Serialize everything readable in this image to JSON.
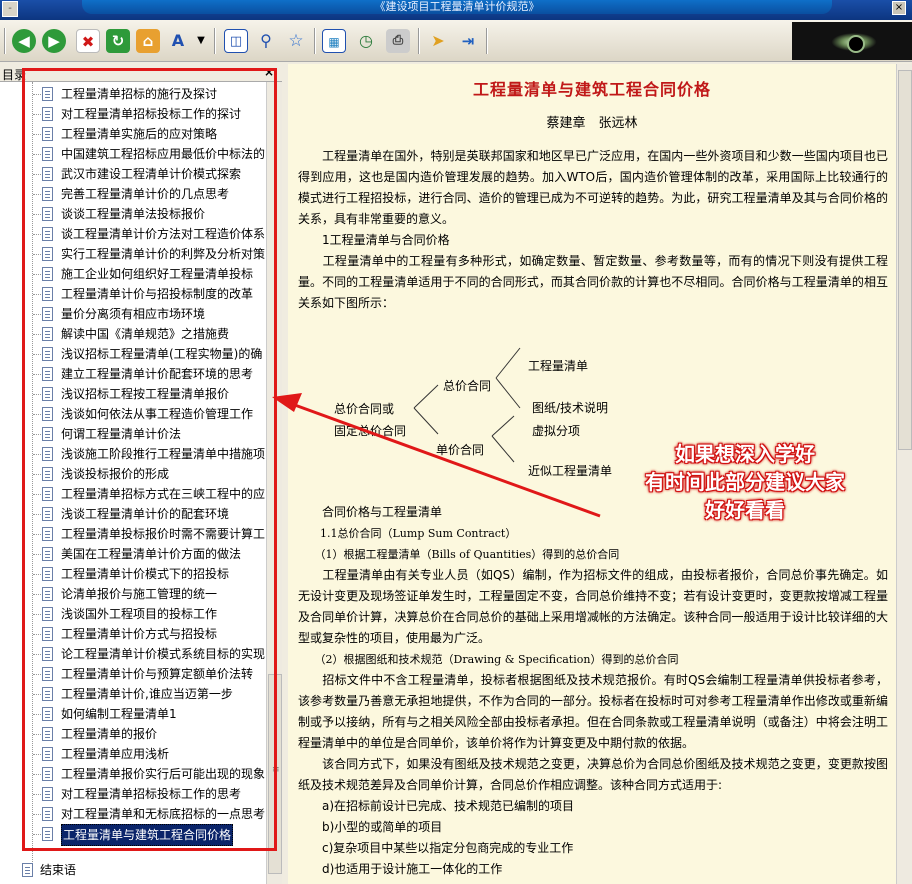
{
  "window": {
    "title": "《建设项目工程量清单计价规范》",
    "left_control": "-",
    "close_label": "×"
  },
  "toolbar": {
    "icons": [
      "back-icon",
      "forward-icon",
      "stop-icon",
      "refresh-icon",
      "home-icon",
      "font-icon",
      "dropdown-icon",
      "panel-icon",
      "search-icon",
      "favorite-icon",
      "image-icon",
      "history-icon",
      "print-icon",
      "pointer-icon",
      "export-icon"
    ]
  },
  "sidebar": {
    "title": "目录",
    "close": "×",
    "items": [
      "工程量清单招标的施行及探讨",
      "对工程量清单招标投标工作的探讨",
      "工程量清单实施后的应对策略",
      "中国建筑工程招标应用最低价中标法的",
      "武汉市建设工程清单计价模式探索",
      "完善工程量清单计价的几点思考",
      "谈谈工程量清单法投标报价",
      "谈工程量清单计价方法对工程造价体系",
      "实行工程量清单计价的利弊及分析对策",
      "施工企业如何组织好工程量清单投标",
      "工程量清单计价与招投标制度的改革",
      "量价分离须有相应市场环境",
      "解读中国《清单规范》之措施费",
      "浅议招标工程量清单(工程实物量)的确",
      "建立工程量清单计价配套环境的思考",
      "浅议招标工程按工程量清单报价",
      "浅谈如何依法从事工程造价管理工作",
      "何谓工程量清单计价法",
      "浅谈施工阶段推行工程量清单中措施项目的",
      "浅谈投标报价的形成",
      "工程量清单招标方式在三峡工程中的应",
      "浅谈工程量清单计价的配套环境",
      "工程量清单投标报价时需不需要计算工",
      "美国在工程量清单计价方面的做法",
      "工程量清单计价模式下的招投标",
      "论清单报价与施工管理的统一",
      "浅谈国外工程项目的投标工作",
      "工程量清单计价方式与招投标",
      "论工程量清单计价模式系统目标的实现",
      "工程量清单计价与预算定额单价法转",
      "工程量清单计价,谁应当迈第一步",
      "如何编制工程量清单1",
      "工程量清单的报价",
      "工程量清单应用浅析",
      "工程量清单报价实行后可能出现的现象",
      "对工程量清单招标投标工作的思考",
      "对工程量清单和无标底招标的一点思考",
      "工程量清单与建筑工程合同价格"
    ],
    "selected_index": 37,
    "last_item": "结束语"
  },
  "article": {
    "title": "工程量清单与建筑工程合同价格",
    "authors": "蔡建章　张远林",
    "p1": "　　工程量清单在国外，特别是英联邦国家和地区早已广泛应用，在国内一些外资项目和少数一些国内项目也已得到应用，这也是国内造价管理发展的趋势。加入WTO后，国内造价管理体制的改革，采用国际上比较通行的模式进行工程招投标，进行合同、造价的管理已成为不可逆转的趋势。为此，研究工程量清单及其与合同价格的关系，具有非常重要的意义。",
    "h1": "　　1工程量清单与合同价格",
    "p2": "　　工程量清单中的工程量有多种形式，如确定数量、暂定数量、参考数量等，而有的情况下则没有提供工程量。不同的工程量清单适用于不同的合同形式，而其合同价款的计算也不尽相同。合同价格与工程量清单的相互关系如下图所示：",
    "diagram": {
      "root1": "总价合同或",
      "root2": "固定总价合同",
      "mid1": "总价合同",
      "mid2": "单价合同",
      "leaf1": "工程量清单",
      "leaf2": "图纸/技术说明",
      "leaf3": "虚拟分项",
      "leaf4": "近似工程量清单"
    },
    "h2": "　　合同价格与工程量清单",
    "h3": "　　1.1总价合同（Lump Sum Contract）",
    "h4": "　　（1）根据工程量清单（Bills of Quantities）得到的总价合同",
    "p3": "　　工程量清单由有关专业人员（如QS）编制，作为招标文件的组成，由投标者报价，合同总价事先确定。如无设计变更及现场签证单发生时，工程量固定不变，合同总价维持不变；若有设计变更时，变更款按增减工程量及合同单价计算，决算总价在合同总价的基础上采用增减帐的方法确定。该种合同一般适用于设计比较详细的大型或复杂性的项目，使用最为广泛。",
    "h5": "　　（2）根据图纸和技术规范（Drawing & Specification）得到的总价合同",
    "p4": "　　招标文件中不含工程量清单，投标者根据图纸及技术规范报价。有时QS会编制工程量清单供投标者参考，该参考数量乃善意无承担地提供，不作为合同的一部分。投标者在投标时可对参考工程量清单作出修改或重新编制或予以接纳，所有与之相关风险全部由投标者承担。但在合同条款或工程量清单说明（或备注）中将会注明工程量清单中的单位是合同单价，该单价将作为计算变更及中期付款的依据。",
    "p5": "　　该合同方式下，如果没有图纸及技术规范之变更，决算总价为合同总价图纸及技术规范之变更，变更款按图纸及技术规范差异及合同单价计算，合同总价作相应调整。该种合同方式适用于:",
    "li1": "　　a)在招标前设计已完成、技术规范已编制的项目",
    "li2": "　　b)小型的或简单的项目",
    "li3": "　　c)复杂项目中某些以指定分包商完成的专业工作",
    "li4": "　　d)也适用于设计施工一体化的工作"
  },
  "annotation": {
    "line1": "如果想深入学好",
    "line2": "有时间此部分建议大家",
    "line3": "好好看看",
    "color": "#e01818"
  }
}
